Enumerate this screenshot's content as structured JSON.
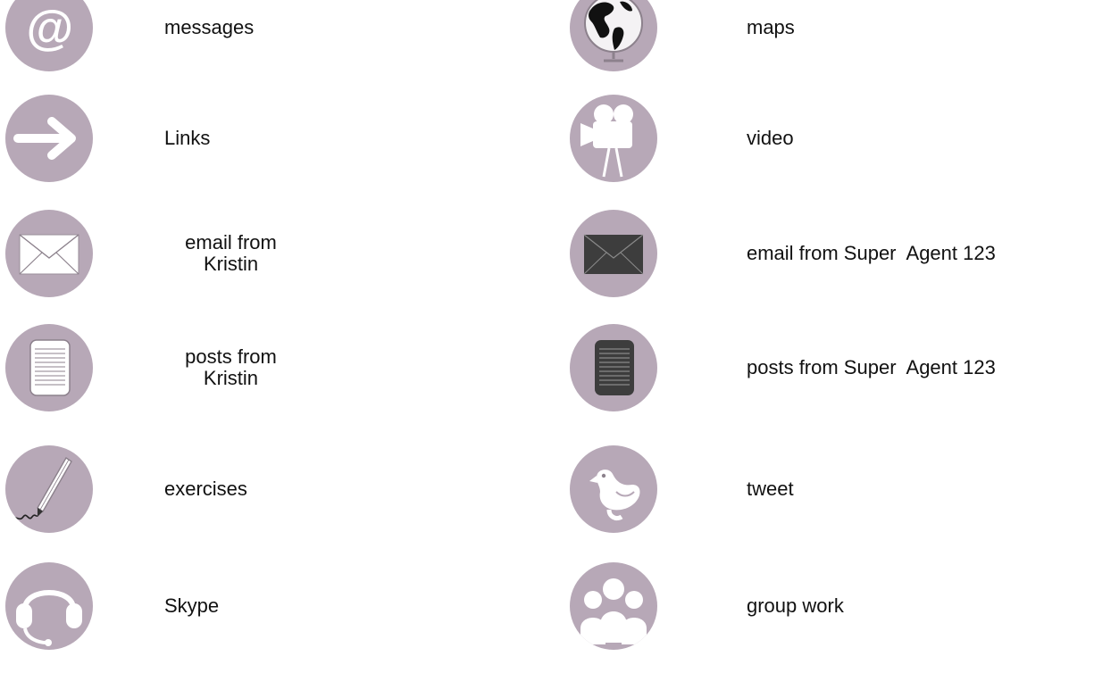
{
  "legend": {
    "left_column": [
      {
        "icon": "at-sign-icon",
        "label": "messages"
      },
      {
        "icon": "arrow-right-icon",
        "label": "Links"
      },
      {
        "icon": "envelope-icon",
        "label": "email from\nKristin"
      },
      {
        "icon": "document-icon",
        "label": "posts from\nKristin"
      },
      {
        "icon": "pen-icon",
        "label": "exercises"
      },
      {
        "icon": "headset-icon",
        "label": "Skype"
      }
    ],
    "right_column": [
      {
        "icon": "globe-icon",
        "label": "maps"
      },
      {
        "icon": "video-camera-icon",
        "label": "video"
      },
      {
        "icon": "dark-envelope-icon",
        "label": "email from Super  Agent 123"
      },
      {
        "icon": "dark-document-icon",
        "label": "posts from Super  Agent 123"
      },
      {
        "icon": "bird-icon",
        "label": "tweet"
      },
      {
        "icon": "group-icon",
        "label": "group work"
      }
    ],
    "colors": {
      "circle": "#b7a8b7",
      "icon_light": "#ffffff",
      "icon_dark": "#3d3d3d",
      "text": "#111111"
    }
  }
}
